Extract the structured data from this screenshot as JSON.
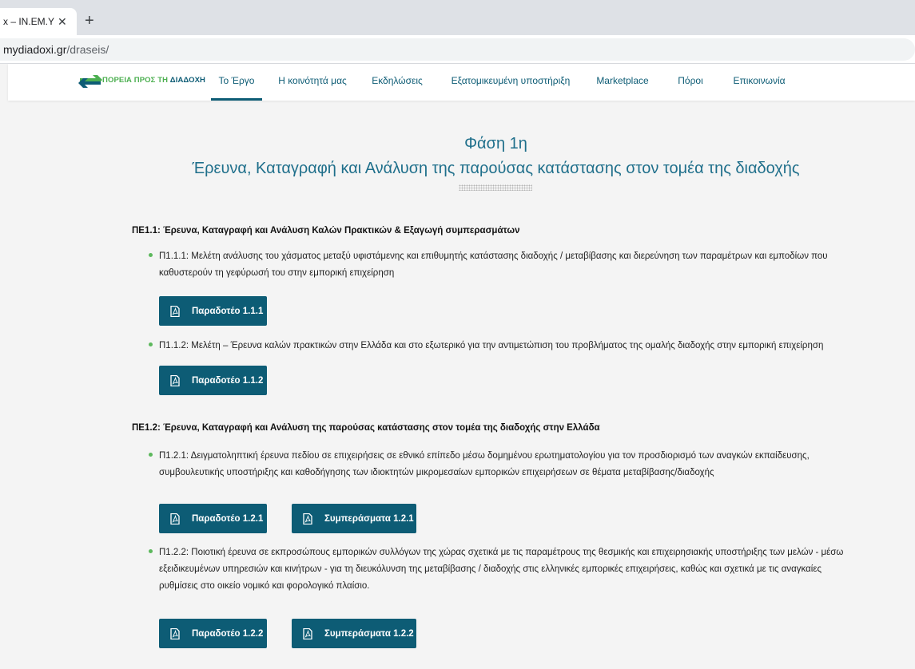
{
  "browser": {
    "tab_title": "x – IN.EM.Y",
    "tab_close": "✕",
    "new_tab": "+",
    "url_host": "mydiadoxi.gr",
    "url_path": "/draseis/"
  },
  "nav": {
    "logo_text_a": "ΠΟΡΕΙΑ ΠΡΟΣ ΤΗ ",
    "logo_text_b": "ΔΙΑΔΟΧΗ",
    "items": [
      {
        "label": "Το Έργο"
      },
      {
        "label": "Η κοινότητά μας"
      },
      {
        "label": "Εκδηλώσεις"
      },
      {
        "label": "Εξατομικευμένη υποστήριξη"
      },
      {
        "label": "Marketplace"
      },
      {
        "label": "Πόροι"
      },
      {
        "label": "Επικοινωνία"
      }
    ]
  },
  "phase": {
    "title": "Φάση 1η",
    "subtitle": "Έρευνα, Καταγραφή και Ανάλυση της παρούσας κατάστασης στον τομέα της διαδοχής"
  },
  "sections": [
    {
      "heading": "ΠΕ1.1: Έρευνα, Καταγραφή και Ανάλυση Καλών Πρακτικών & Εξαγωγή συμπερασμάτων",
      "items": [
        {
          "text": "Π1.1.1: Μελέτη ανάλυσης του χάσματος μεταξύ υφιστάμενης και επιθυμητής κατάστασης διαδοχής / μεταβίβασης και διερεύνηση των παραμέτρων και εμποδίων που καθυστερούν τη γεφύρωσή του στην εμπορική επιχείρηση",
          "buttons": [
            "Παραδοτέο 1.1.1"
          ]
        },
        {
          "text": "Π1.1.2: Μελέτη – Έρευνα καλών πρακτικών στην Ελλάδα και στο εξωτερικό για την αντιμετώπιση του προβλήματος της ομαλής διαδοχής στην εμπορική επιχείρηση",
          "buttons": [
            "Παραδοτέο 1.1.2"
          ]
        }
      ]
    },
    {
      "heading": "ΠΕ1.2: Έρευνα, Καταγραφή και Ανάλυση της παρούσας κατάστασης στον τομέα της διαδοχής στην Ελλάδα",
      "items": [
        {
          "text": "Π1.2.1: Δειγματοληπτική έρευνα πεδίου σε επιχειρήσεις σε εθνικό επίπεδο μέσω δομημένου ερωτηματολογίου για τον προσδιορισμό των αναγκών εκπαίδευσης, συμβουλευτικής υποστήριξης και καθοδήγησης των ιδιοκτητών μικρομεσαίων εμπορικών επιχειρήσεων σε θέματα μεταβίβασης/διαδοχής",
          "buttons": [
            "Παραδοτέο 1.2.1",
            "Συμπεράσματα 1.2.1"
          ]
        },
        {
          "text": "Π1.2.2: Ποιοτική έρευνα σε εκπροσώπους εμπορικών συλλόγων της χώρας σχετικά με τις παραμέτρους της θεσμικής και επιχειρησιακής υποστήριξης των μελών - μέσω εξειδικευμένων υπηρεσιών και κινήτρων - για τη διευκόλυνση της μεταβίβασης / διαδοχής στις ελληνικές εμπορικές επιχειρήσεις, καθώς και σχετικά με τις αναγκαίες ρυθμίσεις στο οικείο νομικό και φορολογικό πλαίσιο.",
          "buttons": [
            "Παραδοτέο 1.2.2",
            "Συμπεράσματα 1.2.2"
          ]
        }
      ]
    }
  ],
  "colors": {
    "primary": "#0d5c75",
    "accent_green": "#4caf50",
    "title": "#1f6f8b"
  }
}
